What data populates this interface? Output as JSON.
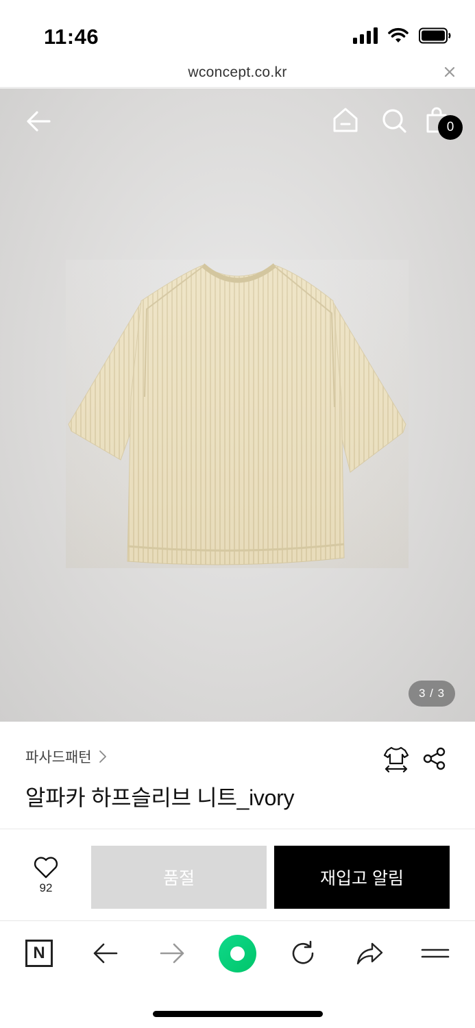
{
  "status_bar": {
    "time": "11:46",
    "icons": [
      "cellular-signal-icon",
      "wifi-icon",
      "battery-icon"
    ]
  },
  "address_bar": {
    "url": "wconcept.co.kr",
    "close_icon": "close-icon"
  },
  "hero": {
    "icons": [
      "back-arrow-icon",
      "home-icon",
      "search-icon",
      "shopping-bag-icon"
    ],
    "cart_count": "0",
    "image_counter": "3 / 3",
    "image_subject": "sweater"
  },
  "product": {
    "brand": "파사드패턴",
    "name": "알파카 하프슬리브 니트_ivory",
    "icons": [
      "size-guide-icon",
      "share-icon"
    ]
  },
  "purchase": {
    "like_count": "92",
    "soldout_label": "품절",
    "restock_label": "재입고 알림"
  },
  "browser_toolbar": {
    "n_label": "N",
    "icons": [
      "naver-icon",
      "back-icon",
      "forward-icon",
      "green-dot-icon",
      "reload-icon",
      "share-icon",
      "menu-icon"
    ]
  },
  "colors": {
    "primary": "#000000",
    "soldout_bg": "#d9d9d9",
    "green": "#0fd98a",
    "sweater": "#ede2c2"
  }
}
